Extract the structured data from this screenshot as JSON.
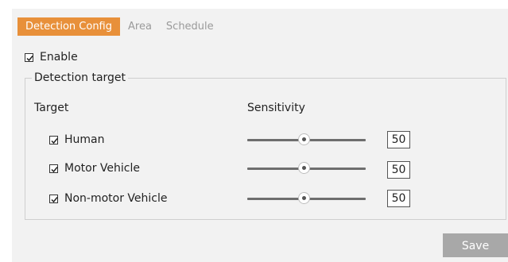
{
  "tabs": [
    {
      "label": "Detection Config",
      "active": true
    },
    {
      "label": "Area",
      "active": false
    },
    {
      "label": "Schedule",
      "active": false
    }
  ],
  "enable": {
    "label": "Enable",
    "checked": true
  },
  "group": {
    "legend": "Detection target",
    "target_header": "Target",
    "sensitivity_header": "Sensitivity",
    "rows": [
      {
        "label": "Human",
        "checked": true,
        "sensitivity": "50"
      },
      {
        "label": "Motor Vehicle",
        "checked": true,
        "sensitivity": "50"
      },
      {
        "label": "Non-motor Vehicle",
        "checked": true,
        "sensitivity": "50"
      }
    ]
  },
  "save_label": "Save",
  "colors": {
    "accent": "#e8903a",
    "panel": "#f2f2f2",
    "save_button": "#a8a8a8"
  }
}
